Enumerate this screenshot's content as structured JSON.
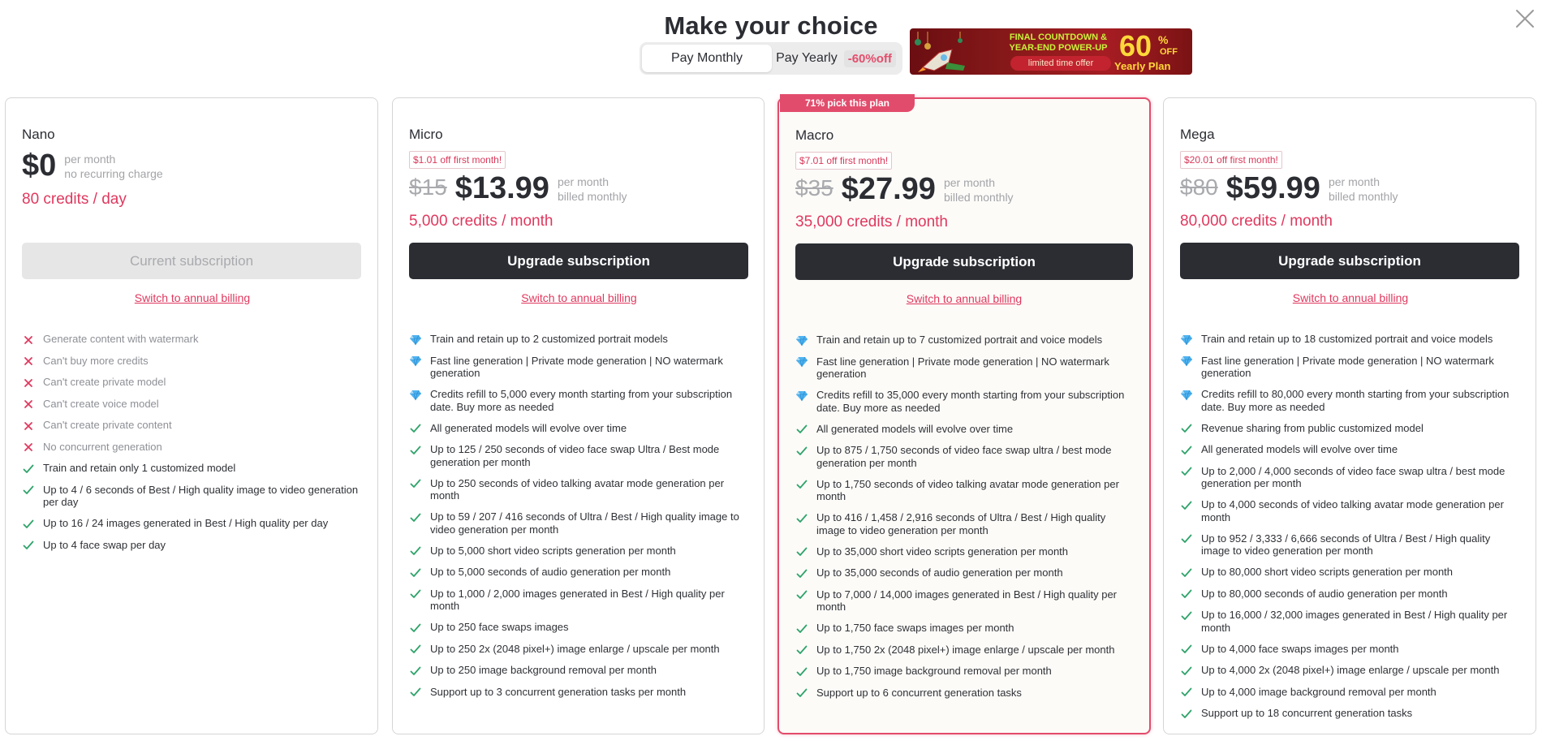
{
  "header": {
    "title": "Make your choice",
    "toggle": {
      "monthly_label": "Pay Monthly",
      "yearly_label": "Pay Yearly",
      "yearly_discount": "-60%off"
    },
    "promo": {
      "headline_1": "FINAL COUNTDOWN &",
      "headline_2": "YEAR-END POWER-UP",
      "pill": "limited time offer",
      "percent": "60",
      "percent_sign": "%",
      "off": "OFF",
      "plan": "Yearly Plan"
    }
  },
  "colors": {
    "accent": "#e0385e",
    "dark_button": "#2b2d33",
    "highlight_border": "#e24c6c",
    "check": "#2ea36a",
    "cross": "#e0385e",
    "diamond": "#4fb3f0"
  },
  "plans": [
    {
      "name": "Nano",
      "price": "$0",
      "per_line1": "per month",
      "per_line2": "no recurring charge",
      "credits": "80 credits / day",
      "button": "Current subscription",
      "switch": "Switch to annual billing",
      "features": [
        {
          "icon": "cross-icon",
          "text": "Generate content with watermark"
        },
        {
          "icon": "cross-icon",
          "text": "Can't buy more credits"
        },
        {
          "icon": "cross-icon",
          "text": "Can't create private model"
        },
        {
          "icon": "cross-icon",
          "text": "Can't create voice model"
        },
        {
          "icon": "cross-icon",
          "text": "Can't create private content"
        },
        {
          "icon": "cross-icon",
          "text": "No concurrent generation"
        },
        {
          "icon": "check-icon",
          "text": "Train and retain only 1 customized model"
        },
        {
          "icon": "check-icon",
          "text": "Up to 4 / 6 seconds of Best / High quality image to video generation per day"
        },
        {
          "icon": "check-icon",
          "text": "Up to 16 / 24 images generated in Best / High quality per day"
        },
        {
          "icon": "check-icon",
          "text": "Up to 4 face swap per day"
        }
      ]
    },
    {
      "name": "Micro",
      "discount": "$1.01 off first month!",
      "old_price": "$15",
      "price": "$13.99",
      "per_line1": "per month",
      "per_line2": "billed monthly",
      "credits": "5,000 credits / month",
      "button": "Upgrade subscription",
      "switch": "Switch to annual billing",
      "features": [
        {
          "icon": "diamond-icon",
          "text": "Train and retain up to 2 customized portrait models"
        },
        {
          "icon": "diamond-icon",
          "text": "Fast line generation | Private mode generation | NO watermark generation"
        },
        {
          "icon": "diamond-icon",
          "text": "Credits refill to 5,000 every month starting from your subscription date. Buy more as needed"
        },
        {
          "icon": "check-icon",
          "text": "All generated models will evolve over time"
        },
        {
          "icon": "check-icon",
          "text": "Up to 125 / 250 seconds of video face swap Ultra / Best mode generation per month"
        },
        {
          "icon": "check-icon",
          "text": "Up to 250 seconds of video talking avatar mode generation per month"
        },
        {
          "icon": "check-icon",
          "text": "Up to 59 / 207 / 416 seconds of Ultra / Best / High quality image to video generation per month"
        },
        {
          "icon": "check-icon",
          "text": "Up to 5,000 short video scripts generation per month"
        },
        {
          "icon": "check-icon",
          "text": "Up to 5,000 seconds of audio generation per month"
        },
        {
          "icon": "check-icon",
          "text": "Up to 1,000 / 2,000 images generated in Best / High quality per month"
        },
        {
          "icon": "check-icon",
          "text": "Up to 250 face swaps images"
        },
        {
          "icon": "check-icon",
          "text": "Up to 250 2x (2048 pixel+) image enlarge / upscale per month"
        },
        {
          "icon": "check-icon",
          "text": "Up to 250 image background removal per month"
        },
        {
          "icon": "check-icon",
          "text": "Support up to 3 concurrent generation tasks per month"
        }
      ]
    },
    {
      "name": "Macro",
      "ribbon": "71% pick this plan",
      "discount": "$7.01 off first month!",
      "old_price": "$35",
      "price": "$27.99",
      "per_line1": "per month",
      "per_line2": "billed monthly",
      "credits": "35,000 credits / month",
      "button": "Upgrade subscription",
      "switch": "Switch to annual billing",
      "features": [
        {
          "icon": "diamond-icon",
          "text": "Train and retain up to 7 customized portrait and voice models"
        },
        {
          "icon": "diamond-icon",
          "text": "Fast line generation | Private mode generation | NO watermark generation"
        },
        {
          "icon": "diamond-icon",
          "text": "Credits refill to 35,000 every month starting from your subscription date. Buy more as needed"
        },
        {
          "icon": "check-icon",
          "text": "All generated models will evolve over time"
        },
        {
          "icon": "check-icon",
          "text": "Up to 875 / 1,750 seconds of video face swap ultra / best mode generation per month"
        },
        {
          "icon": "check-icon",
          "text": "Up to 1,750 seconds of video talking avatar mode generation per month"
        },
        {
          "icon": "check-icon",
          "text": "Up to 416 / 1,458 / 2,916 seconds of Ultra / Best / High quality image to video generation per month"
        },
        {
          "icon": "check-icon",
          "text": "Up to 35,000 short video scripts generation per month"
        },
        {
          "icon": "check-icon",
          "text": "Up to 35,000 seconds of audio generation per month"
        },
        {
          "icon": "check-icon",
          "text": "Up to 7,000 / 14,000 images generated in Best / High quality per month"
        },
        {
          "icon": "check-icon",
          "text": "Up to 1,750 face swaps images per month"
        },
        {
          "icon": "check-icon",
          "text": "Up to 1,750 2x (2048 pixel+) image enlarge / upscale per month"
        },
        {
          "icon": "check-icon",
          "text": "Up to 1,750 image background removal per month"
        },
        {
          "icon": "check-icon",
          "text": "Support up to 6 concurrent generation tasks"
        }
      ]
    },
    {
      "name": "Mega",
      "discount": "$20.01 off first month!",
      "old_price": "$80",
      "price": "$59.99",
      "per_line1": "per month",
      "per_line2": "billed monthly",
      "credits": "80,000 credits / month",
      "button": "Upgrade subscription",
      "switch": "Switch to annual billing",
      "features": [
        {
          "icon": "diamond-icon",
          "text": "Train and retain up to 18 customized portrait and voice models"
        },
        {
          "icon": "diamond-icon",
          "text": "Fast line generation | Private mode generation | NO watermark generation"
        },
        {
          "icon": "diamond-icon",
          "text": "Credits refill to 80,000 every month starting from your subscription date. Buy more as needed"
        },
        {
          "icon": "check-icon",
          "text": "Revenue sharing from public customized model"
        },
        {
          "icon": "check-icon",
          "text": "All generated models will evolve over time"
        },
        {
          "icon": "check-icon",
          "text": "Up to 2,000 / 4,000 seconds of video face swap ultra / best mode generation per month"
        },
        {
          "icon": "check-icon",
          "text": "Up to 4,000 seconds of video talking avatar mode generation per month"
        },
        {
          "icon": "check-icon",
          "text": "Up to 952 / 3,333 / 6,666 seconds of Ultra / Best / High quality image to video generation per month"
        },
        {
          "icon": "check-icon",
          "text": "Up to 80,000 short video scripts generation per month"
        },
        {
          "icon": "check-icon",
          "text": "Up to 80,000 seconds of audio generation per month"
        },
        {
          "icon": "check-icon",
          "text": "Up to 16,000 / 32,000 images generated in Best / High quality per month"
        },
        {
          "icon": "check-icon",
          "text": "Up to 4,000 face swaps images per month"
        },
        {
          "icon": "check-icon",
          "text": "Up to 4,000 2x (2048 pixel+) image enlarge / upscale per month"
        },
        {
          "icon": "check-icon",
          "text": "Up to 4,000 image background removal per month"
        },
        {
          "icon": "check-icon",
          "text": "Support up to 18 concurrent generation tasks"
        }
      ]
    }
  ]
}
